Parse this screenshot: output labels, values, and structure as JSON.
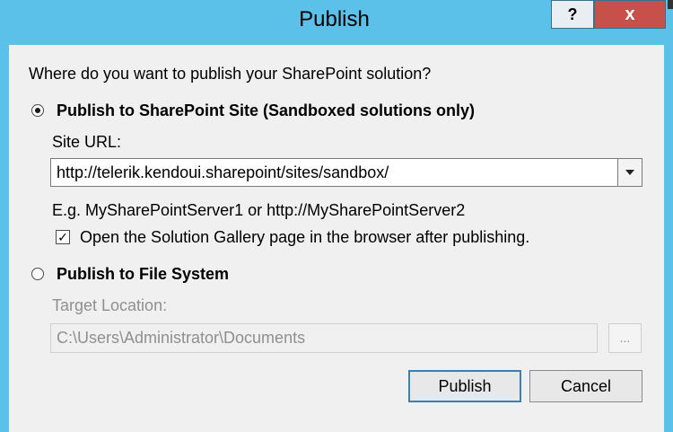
{
  "window": {
    "title": "Publish",
    "help_label": "?",
    "close_label": "x"
  },
  "dialog": {
    "question": "Where do you want to publish your SharePoint solution?",
    "option_site": {
      "label": "Publish to SharePoint Site (Sandboxed solutions only)",
      "selected": true
    },
    "site_url_label": "Site URL:",
    "site_url_value": "http://telerik.kendoui.sharepoint/sites/sandbox/",
    "example_text": "E.g. MySharePointServer1 or http://MySharePointServer2",
    "open_gallery": {
      "label": "Open the Solution Gallery page in the browser after publishing.",
      "checked": true
    },
    "option_file": {
      "label": "Publish to File System",
      "selected": false
    },
    "target_location_label": "Target Location:",
    "target_location_value": "C:\\Users\\Administrator\\Documents",
    "browse_label": "...",
    "publish_button": "Publish",
    "cancel_button": "Cancel"
  },
  "colors": {
    "frame": "#5bc1e8",
    "client": "#f0f0f0",
    "close_button": "#c7504a",
    "default_button_border": "#3c7fb1",
    "disabled_text": "#8f8f8f"
  }
}
